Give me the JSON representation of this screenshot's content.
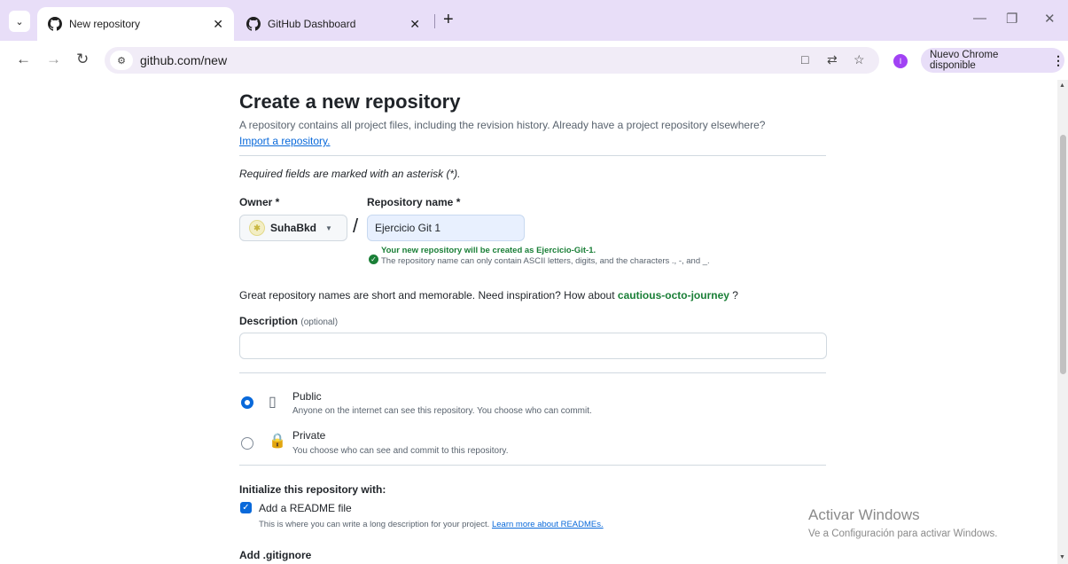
{
  "browser": {
    "tabs": [
      {
        "title": "New repository",
        "active": true
      },
      {
        "title": "GitHub Dashboard",
        "active": false
      }
    ],
    "url": "github.com/new",
    "profile_initial": "I",
    "update_label": "Nuevo Chrome disponible"
  },
  "page": {
    "title": "Create a new repository",
    "subtitle": "A repository contains all project files, including the revision history. Already have a project repository elsewhere?",
    "import_link": "Import a repository.",
    "required_note": "Required fields are marked with an asterisk (*).",
    "owner_label": "Owner *",
    "owner_value": "SuhaBkd",
    "repo_label": "Repository name *",
    "repo_value": "Ejercicio Git 1",
    "success_message": "Your new repository will be created as Ejercicio-Git-1.",
    "hint_message": "The repository name can only contain ASCII letters, digits, and the characters ., -, and _.",
    "inspiration_text": "Great repository names are short and memorable. Need inspiration? How about",
    "suggestion": "cautious-octo-journey",
    "suggestion_tail": "?",
    "description_label": "Description",
    "description_optional": "(optional)",
    "description_value": "",
    "visibility": [
      {
        "title": "Public",
        "description": "Anyone on the internet can see this repository. You choose who can commit.",
        "selected": true,
        "icon": "repo-icon"
      },
      {
        "title": "Private",
        "description": "You choose who can see and commit to this repository.",
        "selected": false,
        "icon": "lock-icon"
      }
    ],
    "init_title": "Initialize this repository with:",
    "readme_label": "Add a README file",
    "readme_checked": true,
    "readme_description": "This is where you can write a long description for your project.",
    "readme_link": "Learn more about READMEs.",
    "gitignore_title": "Add .gitignore"
  },
  "watermark": {
    "title": "Activar Windows",
    "subtitle": "Ve a Configuración para activar Windows."
  },
  "colors": {
    "accent_blue": "#0969da",
    "success_green": "#1a7f37",
    "tab_bar": "#e8def8"
  }
}
